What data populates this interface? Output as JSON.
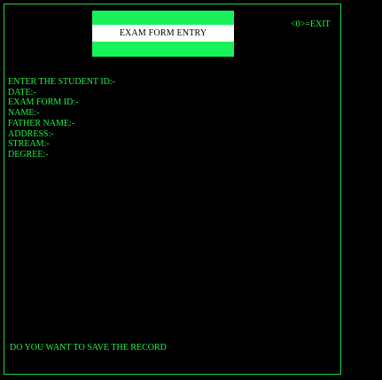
{
  "header": {
    "title": "EXAM FORM ENTRY",
    "exit_hint": "<0>=EXIT"
  },
  "form": {
    "fields": [
      {
        "label": "ENTER THE STUDENT ID:-"
      },
      {
        "label": "DATE:-"
      },
      {
        "label": "EXAM FORM ID:-"
      },
      {
        "label": "NAME:-"
      },
      {
        "label": "FATHER NAME:-"
      },
      {
        "label": "ADDRESS:-"
      },
      {
        "label": "STREAM:-"
      },
      {
        "label": "DEGREE:-"
      }
    ]
  },
  "footer": {
    "save_prompt": "DO YOU WANT TO SAVE THE RECORD"
  },
  "colors": {
    "background": "#000000",
    "text_green": "#1ff24a",
    "title_band": "#17f25a",
    "title_bar": "#ffffff"
  }
}
